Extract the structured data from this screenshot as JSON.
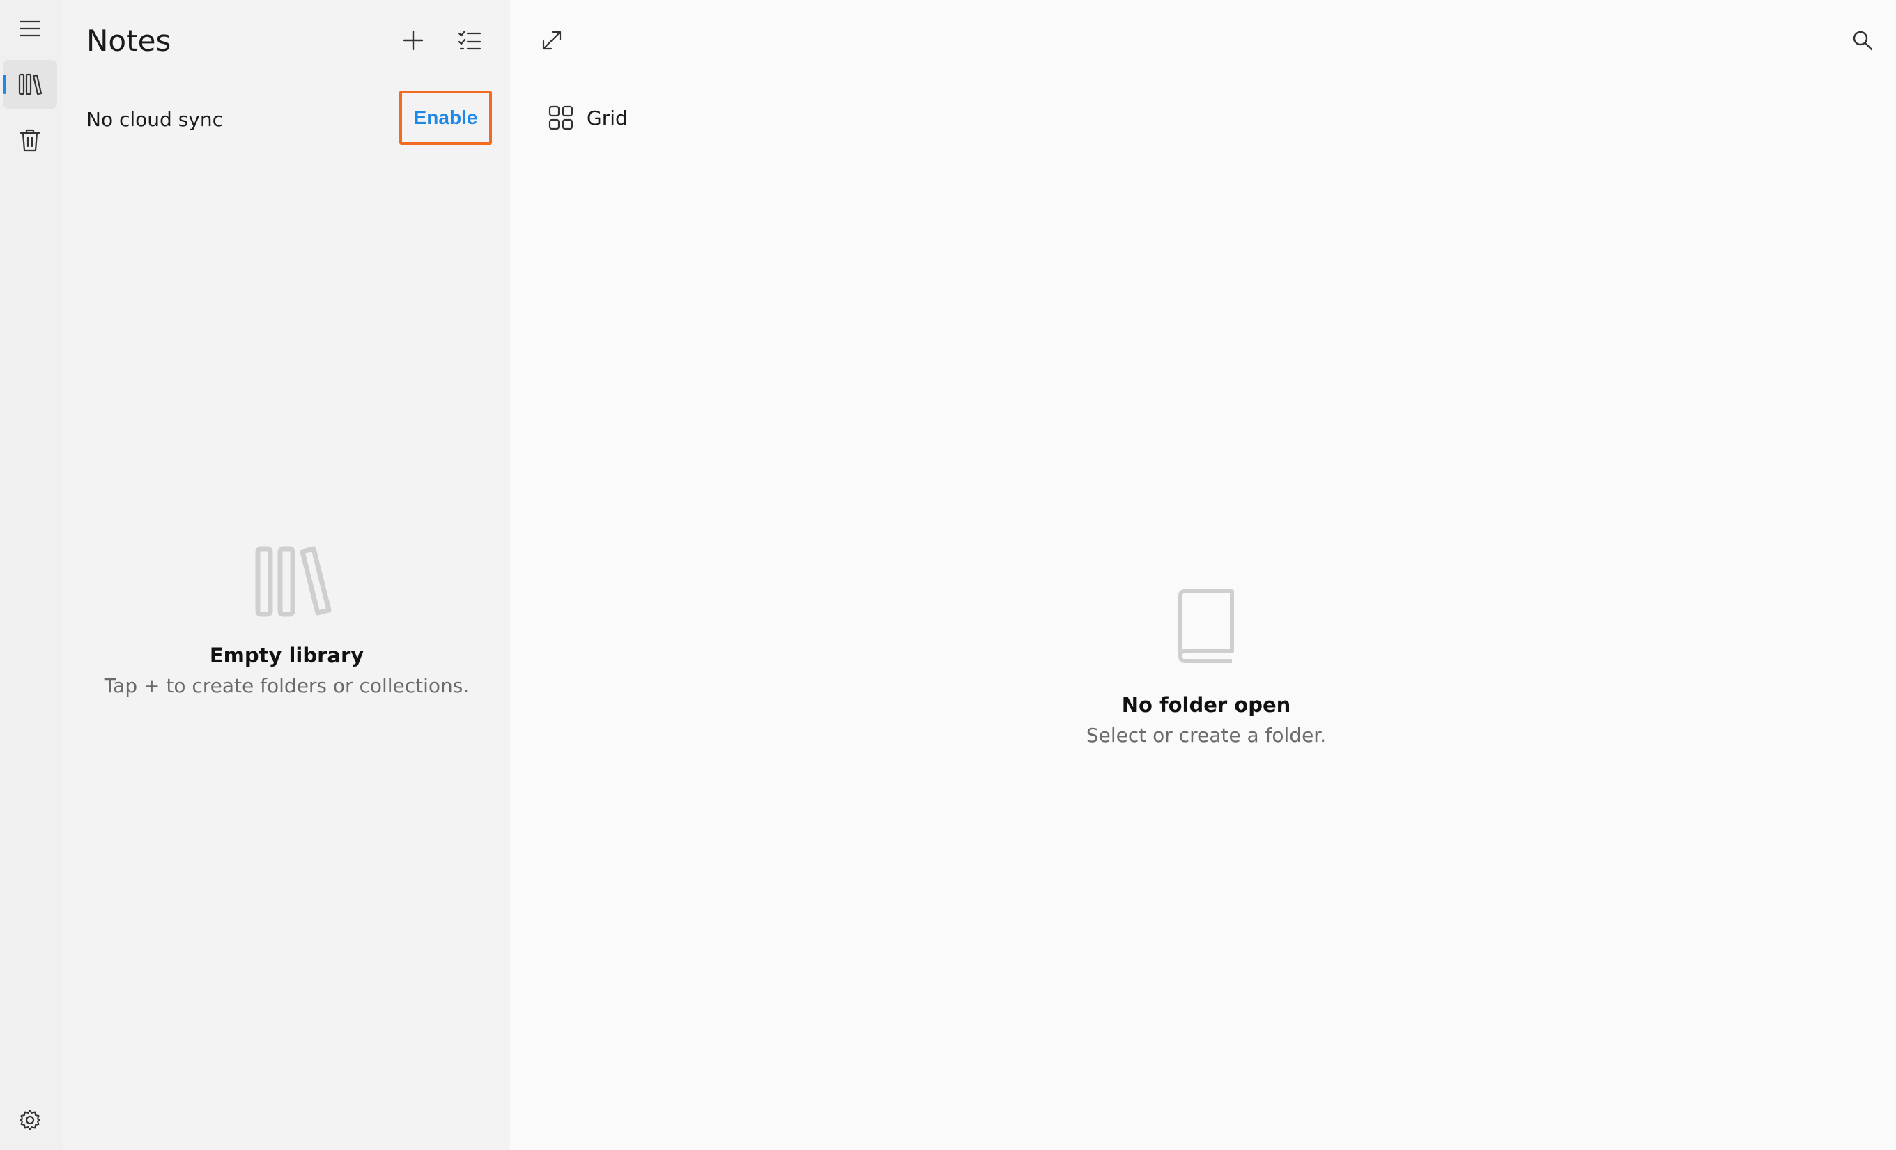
{
  "rail": {
    "menu_icon": "hamburger-menu-icon",
    "library_icon": "books-icon",
    "trash_icon": "trash-icon",
    "settings_icon": "gear-icon"
  },
  "library": {
    "title": "Notes",
    "add_icon": "plus-icon",
    "select_icon": "checklist-icon",
    "sync_text": "No cloud sync",
    "enable_label": "Enable",
    "empty_title": "Empty library",
    "empty_subtitle": "Tap + to create folders or collections."
  },
  "main": {
    "expand_icon": "expand-icon",
    "search_icon": "search-icon",
    "view_label": "Grid",
    "empty_title": "No folder open",
    "empty_subtitle": "Select or create a folder."
  },
  "colors": {
    "accent": "#1e88e5",
    "highlight_border": "#f26b21"
  }
}
